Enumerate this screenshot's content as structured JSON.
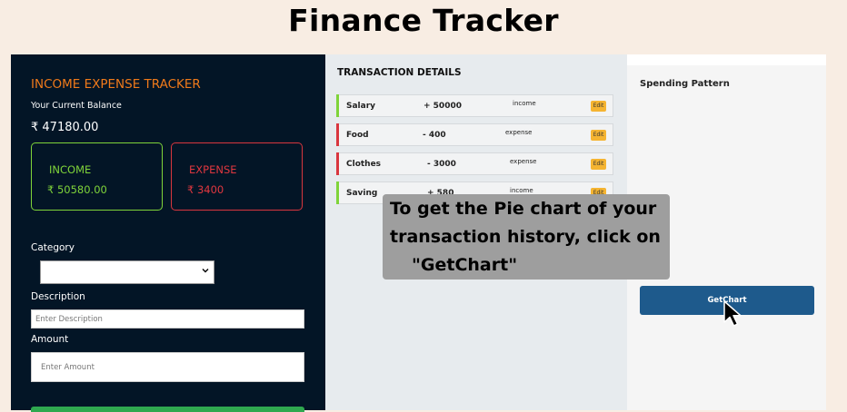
{
  "page_title": "Finance Tracker",
  "tracker": {
    "heading": "INCOME EXPENSE TRACKER",
    "balance_label": "Your Current Balance",
    "balance_value": "₹ 47180.00",
    "income_label": "INCOME",
    "income_value": "₹ 50580.00",
    "expense_label": "EXPENSE",
    "expense_value": "₹ 3400"
  },
  "form": {
    "category_label": "Category",
    "category_selected": "",
    "description_label": "Description",
    "description_placeholder": "Enter Description",
    "amount_label": "Amount",
    "amount_placeholder": "Enter Amount"
  },
  "transactions": {
    "heading": "TRANSACTION DETAILS",
    "edit_label": "Edit",
    "rows": [
      {
        "name": "Salary",
        "amount": "+ 50000",
        "type": "income",
        "color": "#7fd43a"
      },
      {
        "name": "Food",
        "amount": "- 400",
        "type": "expense",
        "color": "#d9363e"
      },
      {
        "name": "Clothes",
        "amount": "- 3000",
        "type": "expense",
        "color": "#d9363e"
      },
      {
        "name": "Saving",
        "amount": "+ 580",
        "type": "income",
        "color": "#7fd43a"
      }
    ]
  },
  "chart_panel": {
    "heading": "Spending Pattern",
    "button_label": "GetChart"
  },
  "tooltip": {
    "line1": "To get the Pie chart of your",
    "line2": "transaction history, click on",
    "line3": "\"GetChart\""
  },
  "colors": {
    "panel_dark": "#031526",
    "accent_orange": "#f07a1a",
    "income_green": "#7fd43a",
    "expense_red": "#d9363e",
    "button_blue": "#1e5a8c",
    "edit_yellow": "#f5b431"
  },
  "icons": {
    "select_arrow": "chevron-down-icon",
    "pointer": "mouse-cursor-icon"
  }
}
